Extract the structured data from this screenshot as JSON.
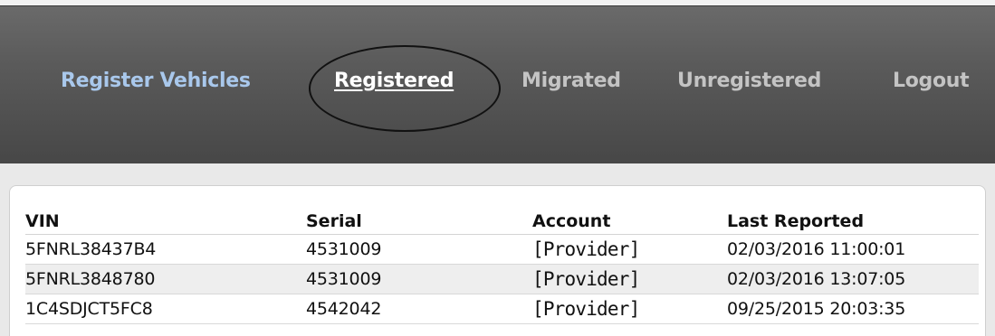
{
  "nav": {
    "items": [
      {
        "label": "Register Vehicles"
      },
      {
        "label": "Registered"
      },
      {
        "label": "Migrated"
      },
      {
        "label": "Unregistered"
      },
      {
        "label": "Logout"
      }
    ]
  },
  "table": {
    "headers": [
      "VIN",
      "Serial",
      "Account",
      "Last Reported"
    ],
    "rows": [
      {
        "vin": "5FNRL38437B4",
        "serial": "4531009",
        "account": "[Provider]",
        "last_reported": "02/03/2016 11:00:01"
      },
      {
        "vin": "5FNRL3848780",
        "serial": "4531009",
        "account": "[Provider]",
        "last_reported": "02/03/2016 13:07:05"
      },
      {
        "vin": "1C4SDJCT5FC8",
        "serial": "4542042",
        "account": "[Provider]",
        "last_reported": "09/25/2015 20:03:35"
      }
    ]
  },
  "colors": {
    "navbar": "#5b5b5b",
    "nav_link_inactive": "#c4c4c4",
    "nav_link_register": "#a9c8ec",
    "nav_link_active": "#ffffff",
    "alt_row": "#eeeeee"
  }
}
